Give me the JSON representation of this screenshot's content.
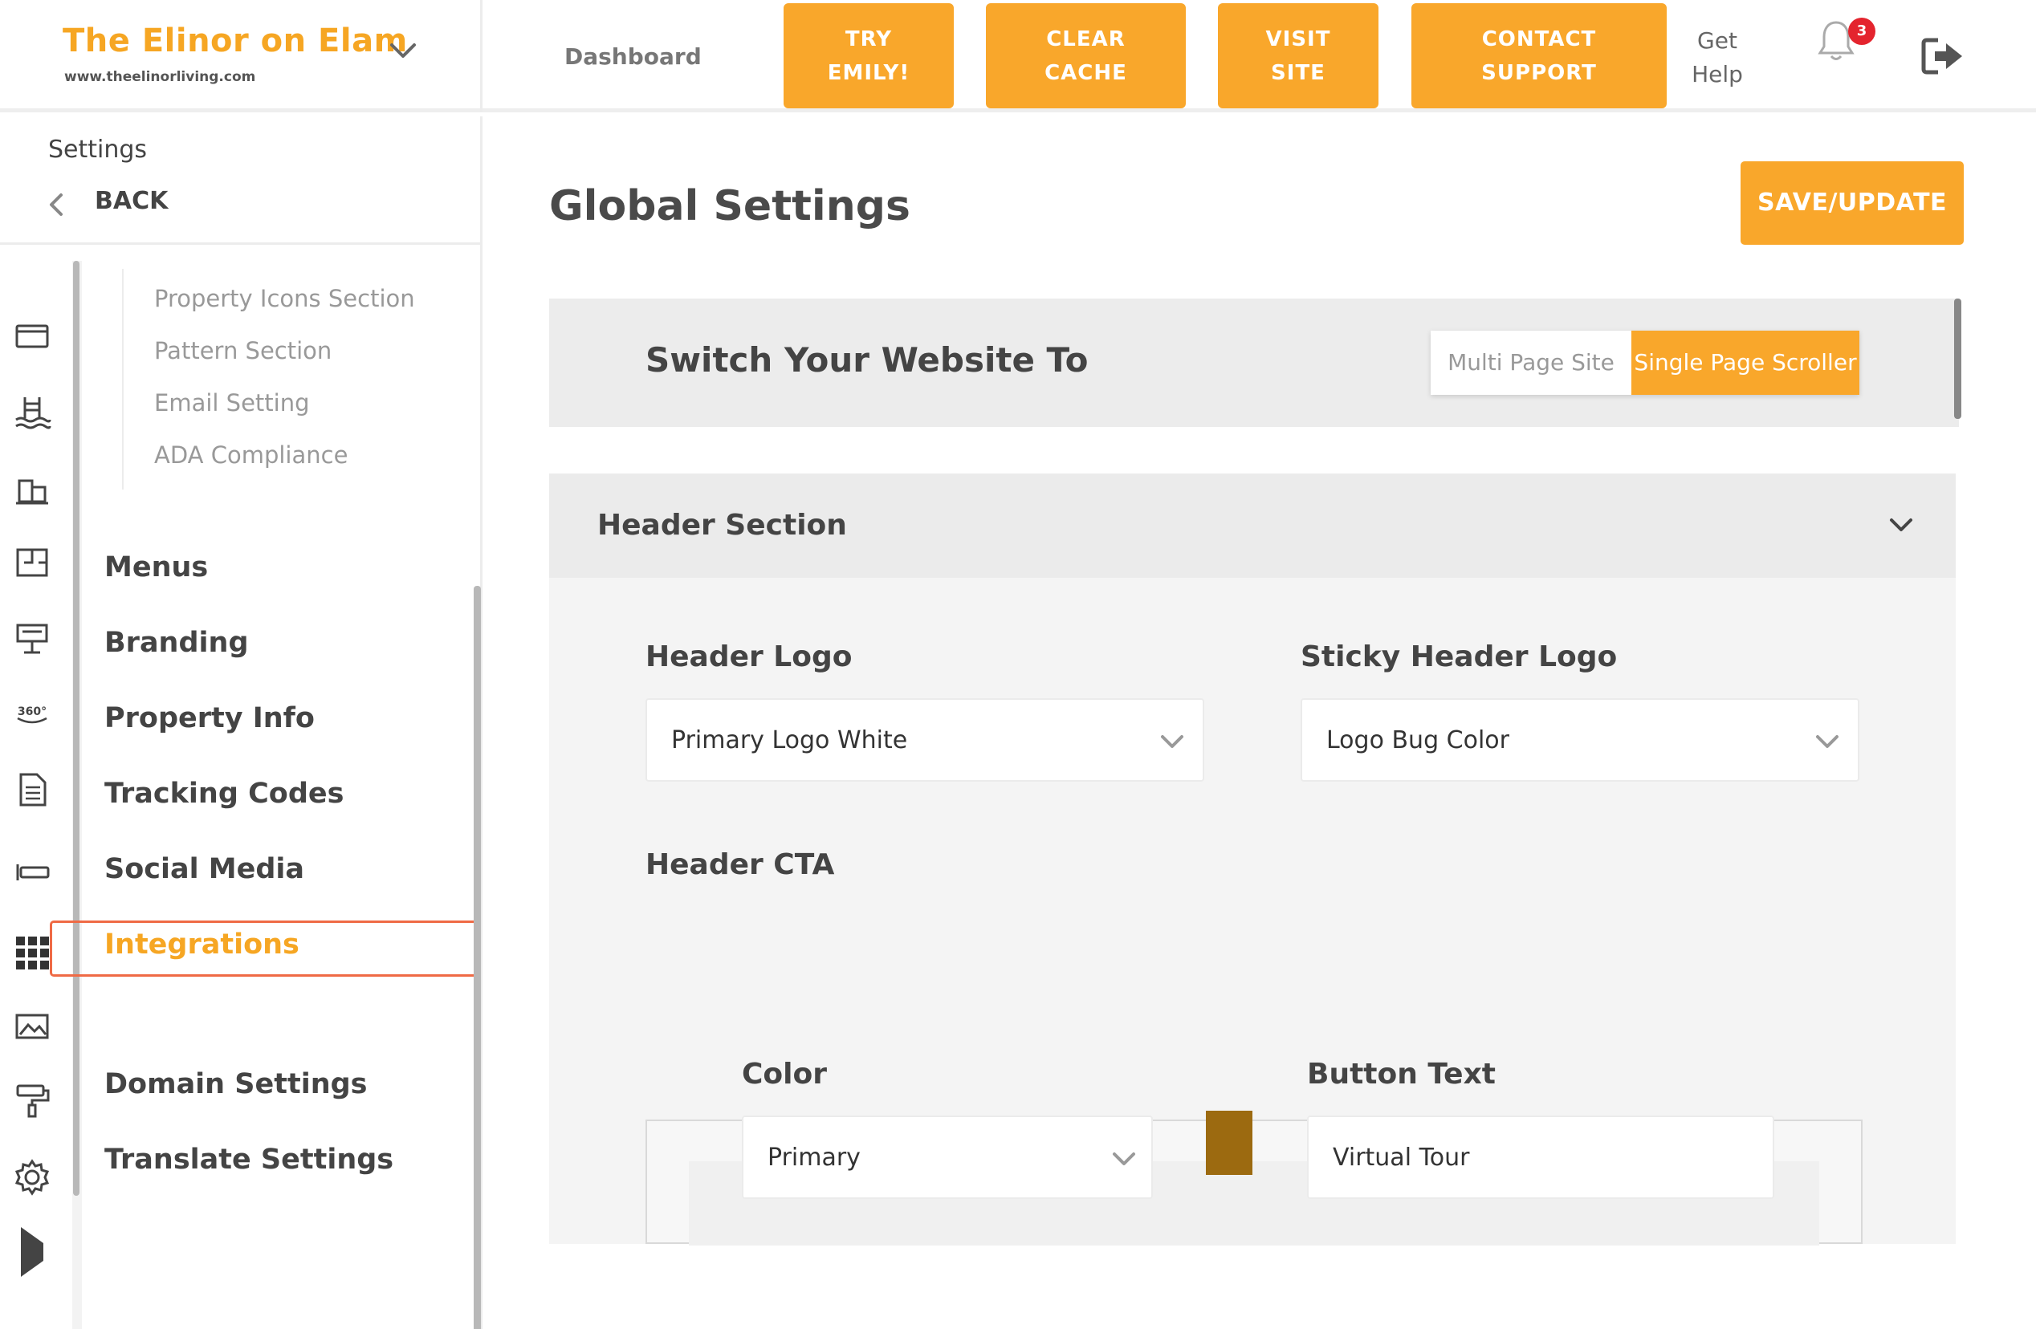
{
  "brand": {
    "name": "The Elinor on Elam",
    "url": "www.theelinorliving.com"
  },
  "nav": {
    "dashboard": "Dashboard",
    "buttons": [
      {
        "line1": "TRY",
        "line2": "EMILY!"
      },
      {
        "line1": "CLEAR",
        "line2": "CACHE"
      },
      {
        "line1": "VISIT",
        "line2": "SITE"
      },
      {
        "line1": "CONTACT",
        "line2": "SUPPORT"
      }
    ],
    "help": {
      "line1": "Get",
      "line2": "Help"
    },
    "notifications_count": "3"
  },
  "sidebar": {
    "title": "Settings",
    "back": "BACK",
    "sub_items": [
      "Property Icons Section",
      "Pattern Section",
      "Email Setting",
      "ADA Compliance"
    ],
    "menu": [
      "Menus",
      "Branding",
      "Property Info",
      "Tracking Codes",
      "Social Media",
      "Integrations",
      "Domain Settings",
      "Translate Settings"
    ],
    "active": "Integrations",
    "rail_icons": [
      "browser-window-icon",
      "pool-icon",
      "buildings-icon",
      "floorplan-icon",
      "amenities-icon",
      "360-tour-icon",
      "document-icon",
      "sign-icon",
      "apps-grid-icon",
      "image-icon",
      "paint-roller-icon",
      "gear-icon",
      "play-icon"
    ]
  },
  "main": {
    "title": "Global Settings",
    "save_button": "SAVE/UPDATE",
    "switch": {
      "title": "Switch Your Website To",
      "options": [
        "Multi Page Site",
        "Single Page Scroller"
      ],
      "selected": "Single Page Scroller"
    },
    "header_section": {
      "title": "Header Section",
      "header_logo": {
        "label": "Header Logo",
        "value": "Primary Logo White"
      },
      "sticky_logo": {
        "label": "Sticky Header Logo",
        "value": "Logo Bug Color"
      },
      "cta": {
        "label": "Header CTA",
        "color": {
          "label": "Color",
          "value": "Primary",
          "swatch": "#9c6a10"
        },
        "button_text": {
          "label": "Button Text",
          "value": "Virtual Tour"
        }
      }
    }
  },
  "colors": {
    "accent": "#f9a72b",
    "brand_text": "#f6a623",
    "active_outline": "#ef6a45",
    "badge": "#e4242e"
  }
}
